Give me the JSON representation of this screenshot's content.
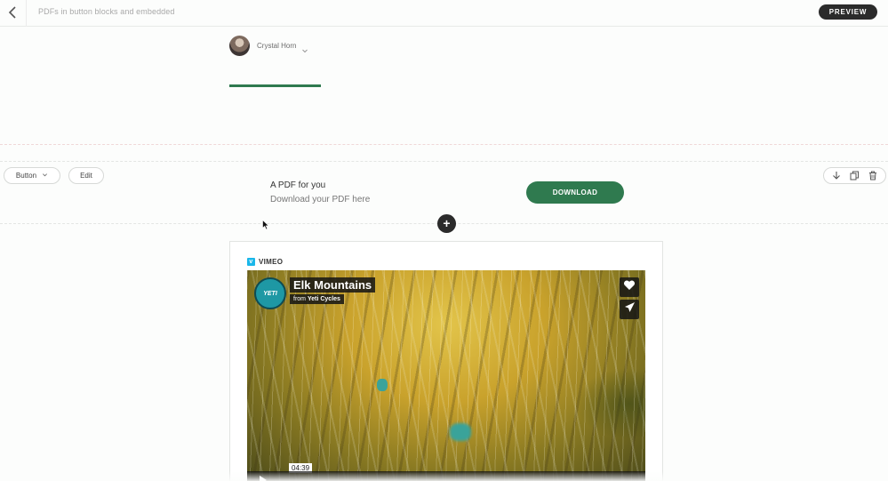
{
  "topbar": {
    "document_title": "PDFs in button blocks and embedded",
    "preview_label": "PREVIEW"
  },
  "author": {
    "name": "Crystal Horn"
  },
  "block_toolbar": {
    "block_type": "Button",
    "edit_label": "Edit"
  },
  "button_block": {
    "title": "A PDF for you",
    "subtitle": "Download your PDF here",
    "button_label": "DOWNLOAD"
  },
  "add_block_label": "+",
  "embed": {
    "provider": "VIMEO",
    "video": {
      "title": "Elk Mountains",
      "byline_prefix": "from",
      "byline_author": "Yeti Cycles",
      "logo_text": "YETI",
      "timestamp": "04:39"
    }
  },
  "colors": {
    "accent_green": "#2f7a4f",
    "dark": "#2b2b2b",
    "vimeo_blue": "#1ab7ea"
  }
}
